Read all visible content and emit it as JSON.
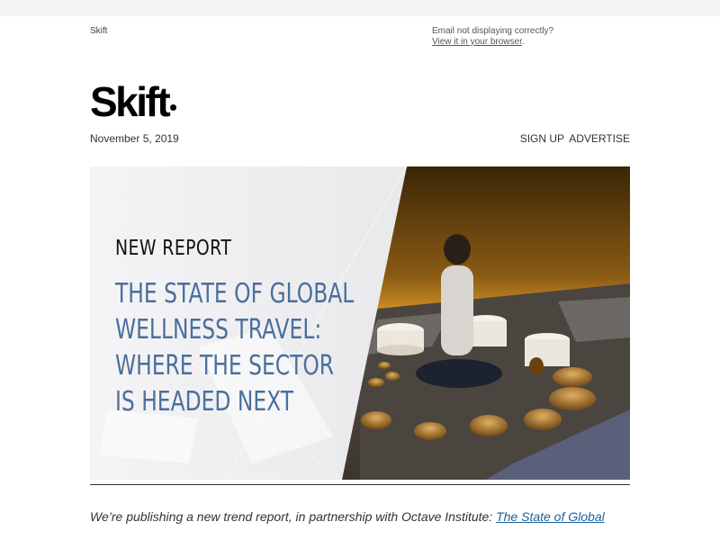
{
  "preheader": {
    "brand": "Skift",
    "not_displaying": "Email not displaying correctly?",
    "view_link": "View it in your browser",
    "view_suffix": "."
  },
  "header": {
    "logo": "Skift",
    "date": "November 5, 2019",
    "nav": [
      "SIGN UP",
      "ADVERTISE"
    ]
  },
  "hero": {
    "kicker": "NEW REPORT",
    "title_lines": [
      "THE STATE OF GLOBAL",
      "WELLNESS TRAVEL:",
      "WHERE THE SECTOR",
      "IS HEADED NEXT"
    ],
    "title_color": "#4a6f9c"
  },
  "intro": {
    "text": "We’re publishing a new trend report, in partnership with Octave Institute: ",
    "link": "The State of Global"
  },
  "colors": {
    "page_bg": "#f4f4f4",
    "link": "#1a5f9e"
  }
}
